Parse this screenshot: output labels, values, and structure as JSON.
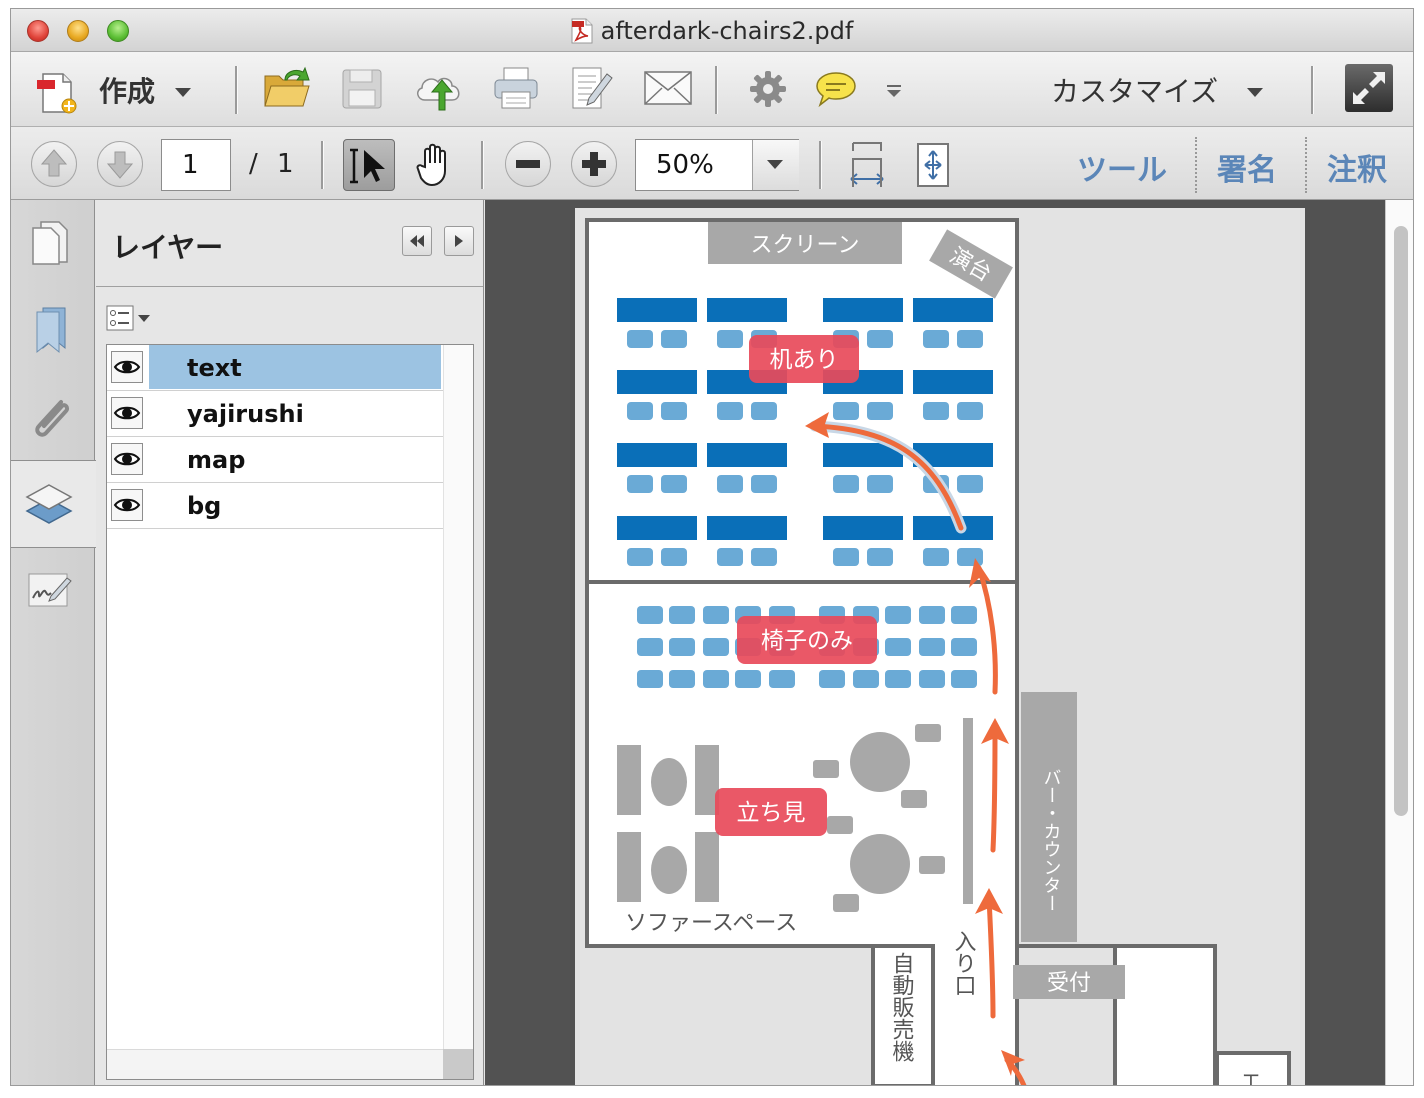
{
  "window": {
    "title": "afterdark-chairs2.pdf"
  },
  "toolbar": {
    "create_label": "作成",
    "customize_label": "カスタマイズ",
    "icons": [
      "create-icon",
      "open-icon",
      "save-icon",
      "cloud-upload-icon",
      "print-icon",
      "edit-icon",
      "mail-icon",
      "gear-icon",
      "comment-icon",
      "toolbar-options-icon",
      "fullscreen-icon"
    ]
  },
  "navigation": {
    "page_current": "1",
    "page_separator": "/",
    "page_total": "1",
    "zoom": "50%",
    "tools_link": "ツール",
    "sign_link": "署名",
    "comment_link": "注釈"
  },
  "layers_panel": {
    "title": "レイヤー",
    "layers": [
      {
        "name": "text",
        "visible": true,
        "selected": true
      },
      {
        "name": "yajirushi",
        "visible": true,
        "selected": false
      },
      {
        "name": "map",
        "visible": true,
        "selected": false
      },
      {
        "name": "bg",
        "visible": true,
        "selected": false
      }
    ]
  },
  "document": {
    "screen": "スクリーン",
    "stage": "演台",
    "zone_desks": "机あり",
    "zone_chairs": "椅子のみ",
    "zone_standing": "立ち見",
    "sofa_space": "ソファースペース",
    "bar_counter": "バー・カウンター",
    "entrance": "入り口",
    "vending": "自動販売機",
    "reception": "受付",
    "edge_label": "エ"
  },
  "colors": {
    "desk": "#0a6fb8",
    "chair": "#6aaad6",
    "zone_label": "#e84a5a",
    "arrow": "#ee6a3c",
    "fixture_gray": "#a8a8a8",
    "wall": "#6b6b6b",
    "selection": "#9cc3e2",
    "link": "#5b86b8"
  }
}
